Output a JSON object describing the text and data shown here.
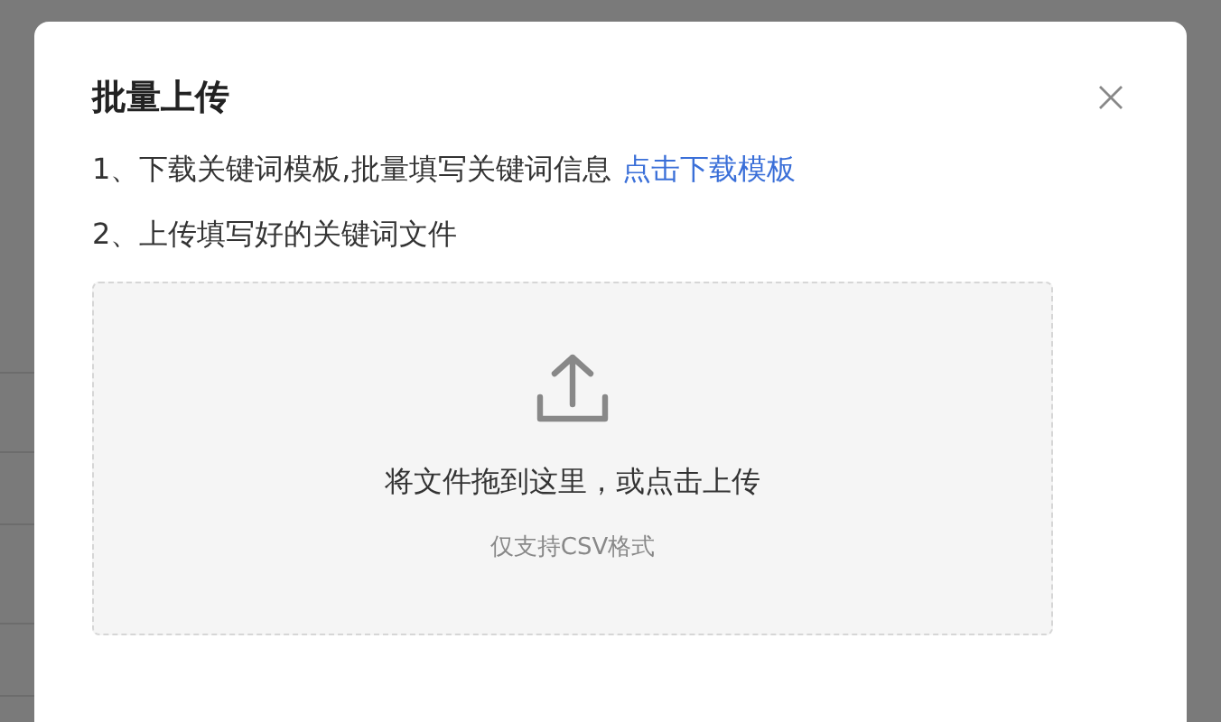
{
  "dialog": {
    "title": "批量上传",
    "steps": [
      {
        "text": "1、下载关键词模板,批量填写关键词信息",
        "link": "点击下载模板"
      },
      {
        "text": "2、上传填写好的关键词文件"
      }
    ],
    "dropzone": {
      "prompt": "将文件拖到这里，或点击上传",
      "hint": "仅支持CSV格式"
    }
  }
}
